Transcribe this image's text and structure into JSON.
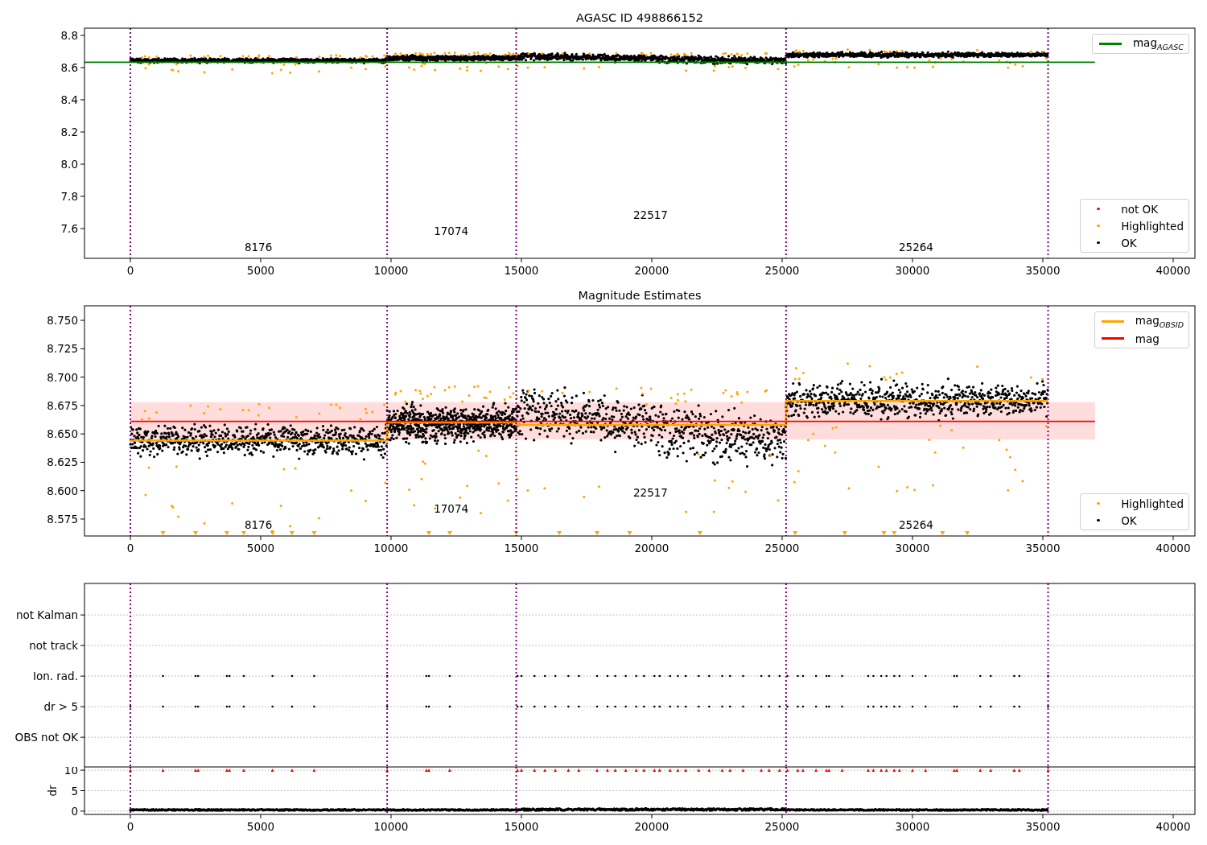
{
  "figure": {
    "panels": [
      {
        "chart_data": {
          "type": "line",
          "title": "AGASC ID 498866152",
          "xlim": [
            -1759,
            40833
          ],
          "ylim": [
            7.415,
            8.845
          ],
          "legend": "upper right",
          "xticks": [
            0,
            5000,
            10000,
            15000,
            20000,
            25000,
            30000,
            35000,
            40000
          ],
          "yticks": [
            {
              "value": 7.6,
              "label": "7.6"
            },
            {
              "value": 7.8,
              "label": "7.8"
            },
            {
              "value": 8.0,
              "label": "8.0"
            },
            {
              "value": 8.2,
              "label": "8.2"
            },
            {
              "value": 8.4,
              "label": "8.4"
            },
            {
              "value": 8.6,
              "label": "8.6"
            },
            {
              "value": 8.8,
              "label": "8.8"
            }
          ],
          "series": [
            {
              "name": "mag$_{AGASC}$",
              "color": "#008000",
              "x": [
                -1759,
                37000
              ],
              "values": [
                8.633,
                8.633
              ]
            }
          ],
          "ref_lines": [
            {
              "axis": "x",
              "value": 0,
              "color": "#800080"
            },
            {
              "axis": "x",
              "value": 9850,
              "color": "#800080"
            },
            {
              "axis": "x",
              "value": 14800,
              "color": "#800080"
            },
            {
              "axis": "x",
              "value": 25150,
              "color": "#800080"
            },
            {
              "axis": "x",
              "value": 35200,
              "color": "#800080"
            }
          ],
          "annotations": [
            "8176",
            "17074",
            "22517",
            "25264"
          ]
        },
        "legends": [
          {
            "entries": [
              {
                "label": "not OK",
                "color": "#ff0000"
              },
              {
                "label": "Highlighted",
                "color": "#ffa500"
              },
              {
                "label": "OK",
                "color": "#000000"
              }
            ]
          }
        ]
      },
      {
        "chart_data": {
          "type": "line",
          "title": "Magnitude Estimates",
          "xlim": [
            -1759,
            40833
          ],
          "ylim": [
            8.5601,
            8.7628
          ],
          "legend": "upper right",
          "xticks": [
            0,
            5000,
            10000,
            15000,
            20000,
            25000,
            30000,
            35000,
            40000
          ],
          "yticks": [
            {
              "value": 8.575,
              "label": "8.575"
            },
            {
              "value": 8.6,
              "label": "8.600"
            },
            {
              "value": 8.625,
              "label": "8.625"
            },
            {
              "value": 8.65,
              "label": "8.650"
            },
            {
              "value": 8.675,
              "label": "8.675"
            },
            {
              "value": 8.7,
              "label": "8.700"
            },
            {
              "value": 8.725,
              "label": "8.725"
            },
            {
              "value": 8.75,
              "label": "8.750"
            }
          ],
          "series": [
            {
              "name": "mag$_{OBSID}$",
              "color": "#ffa500",
              "x": [
                0,
                9850,
                9850,
                14800,
                14800,
                25150,
                25150,
                35200
              ],
              "values": [
                8.644,
                8.644,
                8.66,
                8.66,
                8.658,
                8.658,
                8.679,
                8.679
              ]
            },
            {
              "name": "mag",
              "color": "#ff0000",
              "x": [
                0,
                37000
              ],
              "values": [
                8.661,
                8.661
              ]
            }
          ],
          "bands": [
            {
              "axis": "y",
              "from": 8.645,
              "to": 8.678,
              "color": "#ffdddd"
            }
          ],
          "ref_lines": [
            {
              "axis": "x",
              "value": 0,
              "color": "#800080"
            },
            {
              "axis": "x",
              "value": 9850,
              "color": "#800080"
            },
            {
              "axis": "x",
              "value": 14800,
              "color": "#800080"
            },
            {
              "axis": "x",
              "value": 25150,
              "color": "#800080"
            },
            {
              "axis": "x",
              "value": 35200,
              "color": "#800080"
            }
          ],
          "annotations": [
            "8176",
            "17074",
            "22517",
            "25264"
          ]
        },
        "legends": [
          {
            "entries": [
              {
                "label": "Highlighted",
                "color": "#ffa500"
              },
              {
                "label": "OK",
                "color": "#000000"
              }
            ]
          }
        ]
      },
      {
        "chart_data": {
          "type": "other",
          "categories": [
            "OBS not OK",
            "dr > 5",
            "Ion. rad.",
            "not track",
            "not Kalman"
          ]
        }
      },
      {
        "chart_data": {
          "type": "scatter",
          "ylabel": "dr",
          "xlim": [
            -1759,
            40833
          ],
          "ylim": [
            -0.8,
            10.8
          ],
          "grid": true,
          "xticks": [
            0,
            5000,
            10000,
            15000,
            20000,
            25000,
            30000,
            35000,
            40000
          ],
          "yticks": [
            0,
            5,
            10
          ],
          "series": [
            {
              "color": "#ff0000",
              "x": [
                0,
                1250,
                2500,
                2600,
                3700,
                3800,
                4350,
                5450,
                6200,
                7050,
                9850,
                11350,
                11450,
                12250,
                14850,
                15000,
                15500,
                15900,
                16300,
                16800,
                17200,
                17900,
                18300,
                18600,
                19000,
                19400,
                19700,
                20100,
                20300,
                20700,
                21000,
                21300,
                21800,
                22200,
                22700,
                23000,
                23500,
                24200,
                24500,
                24900,
                25200,
                25600,
                25800,
                26300,
                26700,
                26800,
                27300,
                28300,
                28500,
                28800,
                29000,
                29300,
                29500,
                30000,
                30500,
                31600,
                31700,
                32600,
                33000,
                33900,
                34100,
                35200
              ],
              "values": [
                10,
                10,
                10,
                10,
                10,
                10,
                10,
                10,
                10,
                10,
                10,
                10,
                10,
                10,
                10,
                10,
                10,
                10,
                10,
                10,
                10,
                10,
                10,
                10,
                10,
                10,
                10,
                10,
                10,
                10,
                10,
                10,
                10,
                10,
                10,
                10,
                10,
                10,
                10,
                10,
                10,
                10,
                10,
                10,
                10,
                10,
                10,
                10,
                10,
                10,
                10,
                10,
                10,
                10,
                10,
                10,
                10,
                10,
                10,
                10,
                10,
                10
              ]
            }
          ],
          "ref_lines": [
            {
              "axis": "x",
              "value": 0,
              "color": "#800080"
            },
            {
              "axis": "x",
              "value": 9850,
              "color": "#800080"
            },
            {
              "axis": "x",
              "value": 14800,
              "color": "#800080"
            },
            {
              "axis": "x",
              "value": 25150,
              "color": "#800080"
            },
            {
              "axis": "x",
              "value": 35200,
              "color": "#800080"
            }
          ]
        }
      }
    ]
  }
}
